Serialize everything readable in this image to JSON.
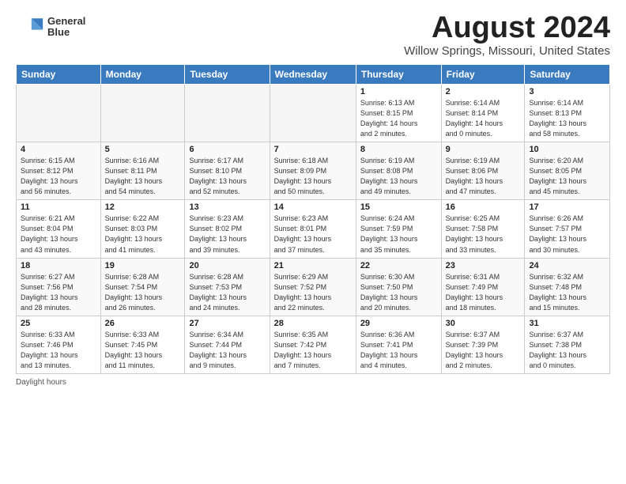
{
  "logo": {
    "line1": "General",
    "line2": "Blue"
  },
  "title": "August 2024",
  "subtitle": "Willow Springs, Missouri, United States",
  "headers": [
    "Sunday",
    "Monday",
    "Tuesday",
    "Wednesday",
    "Thursday",
    "Friday",
    "Saturday"
  ],
  "footer": "Daylight hours",
  "weeks": [
    [
      {
        "day": "",
        "info": ""
      },
      {
        "day": "",
        "info": ""
      },
      {
        "day": "",
        "info": ""
      },
      {
        "day": "",
        "info": ""
      },
      {
        "day": "1",
        "info": "Sunrise: 6:13 AM\nSunset: 8:15 PM\nDaylight: 14 hours\nand 2 minutes."
      },
      {
        "day": "2",
        "info": "Sunrise: 6:14 AM\nSunset: 8:14 PM\nDaylight: 14 hours\nand 0 minutes."
      },
      {
        "day": "3",
        "info": "Sunrise: 6:14 AM\nSunset: 8:13 PM\nDaylight: 13 hours\nand 58 minutes."
      }
    ],
    [
      {
        "day": "4",
        "info": "Sunrise: 6:15 AM\nSunset: 8:12 PM\nDaylight: 13 hours\nand 56 minutes."
      },
      {
        "day": "5",
        "info": "Sunrise: 6:16 AM\nSunset: 8:11 PM\nDaylight: 13 hours\nand 54 minutes."
      },
      {
        "day": "6",
        "info": "Sunrise: 6:17 AM\nSunset: 8:10 PM\nDaylight: 13 hours\nand 52 minutes."
      },
      {
        "day": "7",
        "info": "Sunrise: 6:18 AM\nSunset: 8:09 PM\nDaylight: 13 hours\nand 50 minutes."
      },
      {
        "day": "8",
        "info": "Sunrise: 6:19 AM\nSunset: 8:08 PM\nDaylight: 13 hours\nand 49 minutes."
      },
      {
        "day": "9",
        "info": "Sunrise: 6:19 AM\nSunset: 8:06 PM\nDaylight: 13 hours\nand 47 minutes."
      },
      {
        "day": "10",
        "info": "Sunrise: 6:20 AM\nSunset: 8:05 PM\nDaylight: 13 hours\nand 45 minutes."
      }
    ],
    [
      {
        "day": "11",
        "info": "Sunrise: 6:21 AM\nSunset: 8:04 PM\nDaylight: 13 hours\nand 43 minutes."
      },
      {
        "day": "12",
        "info": "Sunrise: 6:22 AM\nSunset: 8:03 PM\nDaylight: 13 hours\nand 41 minutes."
      },
      {
        "day": "13",
        "info": "Sunrise: 6:23 AM\nSunset: 8:02 PM\nDaylight: 13 hours\nand 39 minutes."
      },
      {
        "day": "14",
        "info": "Sunrise: 6:23 AM\nSunset: 8:01 PM\nDaylight: 13 hours\nand 37 minutes."
      },
      {
        "day": "15",
        "info": "Sunrise: 6:24 AM\nSunset: 7:59 PM\nDaylight: 13 hours\nand 35 minutes."
      },
      {
        "day": "16",
        "info": "Sunrise: 6:25 AM\nSunset: 7:58 PM\nDaylight: 13 hours\nand 33 minutes."
      },
      {
        "day": "17",
        "info": "Sunrise: 6:26 AM\nSunset: 7:57 PM\nDaylight: 13 hours\nand 30 minutes."
      }
    ],
    [
      {
        "day": "18",
        "info": "Sunrise: 6:27 AM\nSunset: 7:56 PM\nDaylight: 13 hours\nand 28 minutes."
      },
      {
        "day": "19",
        "info": "Sunrise: 6:28 AM\nSunset: 7:54 PM\nDaylight: 13 hours\nand 26 minutes."
      },
      {
        "day": "20",
        "info": "Sunrise: 6:28 AM\nSunset: 7:53 PM\nDaylight: 13 hours\nand 24 minutes."
      },
      {
        "day": "21",
        "info": "Sunrise: 6:29 AM\nSunset: 7:52 PM\nDaylight: 13 hours\nand 22 minutes."
      },
      {
        "day": "22",
        "info": "Sunrise: 6:30 AM\nSunset: 7:50 PM\nDaylight: 13 hours\nand 20 minutes."
      },
      {
        "day": "23",
        "info": "Sunrise: 6:31 AM\nSunset: 7:49 PM\nDaylight: 13 hours\nand 18 minutes."
      },
      {
        "day": "24",
        "info": "Sunrise: 6:32 AM\nSunset: 7:48 PM\nDaylight: 13 hours\nand 15 minutes."
      }
    ],
    [
      {
        "day": "25",
        "info": "Sunrise: 6:33 AM\nSunset: 7:46 PM\nDaylight: 13 hours\nand 13 minutes."
      },
      {
        "day": "26",
        "info": "Sunrise: 6:33 AM\nSunset: 7:45 PM\nDaylight: 13 hours\nand 11 minutes."
      },
      {
        "day": "27",
        "info": "Sunrise: 6:34 AM\nSunset: 7:44 PM\nDaylight: 13 hours\nand 9 minutes."
      },
      {
        "day": "28",
        "info": "Sunrise: 6:35 AM\nSunset: 7:42 PM\nDaylight: 13 hours\nand 7 minutes."
      },
      {
        "day": "29",
        "info": "Sunrise: 6:36 AM\nSunset: 7:41 PM\nDaylight: 13 hours\nand 4 minutes."
      },
      {
        "day": "30",
        "info": "Sunrise: 6:37 AM\nSunset: 7:39 PM\nDaylight: 13 hours\nand 2 minutes."
      },
      {
        "day": "31",
        "info": "Sunrise: 6:37 AM\nSunset: 7:38 PM\nDaylight: 13 hours\nand 0 minutes."
      }
    ]
  ]
}
